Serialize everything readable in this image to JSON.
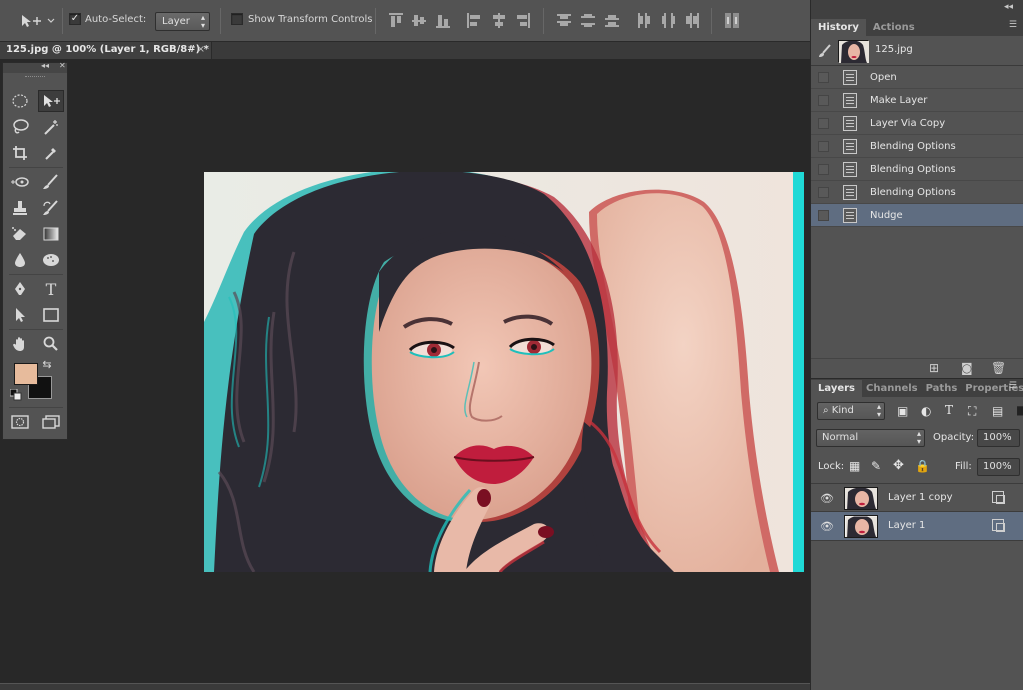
{
  "options_bar": {
    "auto_select_label": "Auto-Select:",
    "auto_select_checked": true,
    "layer_select_value": "Layer",
    "show_transform_label": "Show Transform Controls",
    "show_transform_checked": false
  },
  "document": {
    "tab_title": "125.jpg @ 100% (Layer 1, RGB/8#) *",
    "close_glyph": "×"
  },
  "toolbox": {
    "foreground_color": "#e7bb9c",
    "background_color": "#111111"
  },
  "history_panel": {
    "tabs": [
      "History",
      "Actions"
    ],
    "snapshot_name": "125.jpg",
    "states": [
      "Open",
      "Make Layer",
      "Layer Via Copy",
      "Blending Options",
      "Blending Options",
      "Blending Options",
      "Nudge"
    ],
    "selected_state": "Nudge"
  },
  "layers_panel": {
    "tabs": [
      "Layers",
      "Channels",
      "Paths",
      "Properties"
    ],
    "filter_kind": "Kind",
    "blend_mode": "Normal",
    "opacity_label": "Opacity:",
    "opacity_value": "100%",
    "lock_label": "Lock:",
    "fill_label": "Fill:",
    "fill_value": "100%",
    "layers": [
      {
        "name": "Layer 1 copy",
        "visible": true,
        "selected": false
      },
      {
        "name": "Layer 1",
        "visible": true,
        "selected": true
      }
    ]
  },
  "colors": {
    "selection_highlight": "#5f6d81",
    "panel_bg": "#535353",
    "canvas_bg": "#282828",
    "anaglyph_cyan": "#1fd9d6",
    "anaglyph_red": "#c8323c"
  }
}
